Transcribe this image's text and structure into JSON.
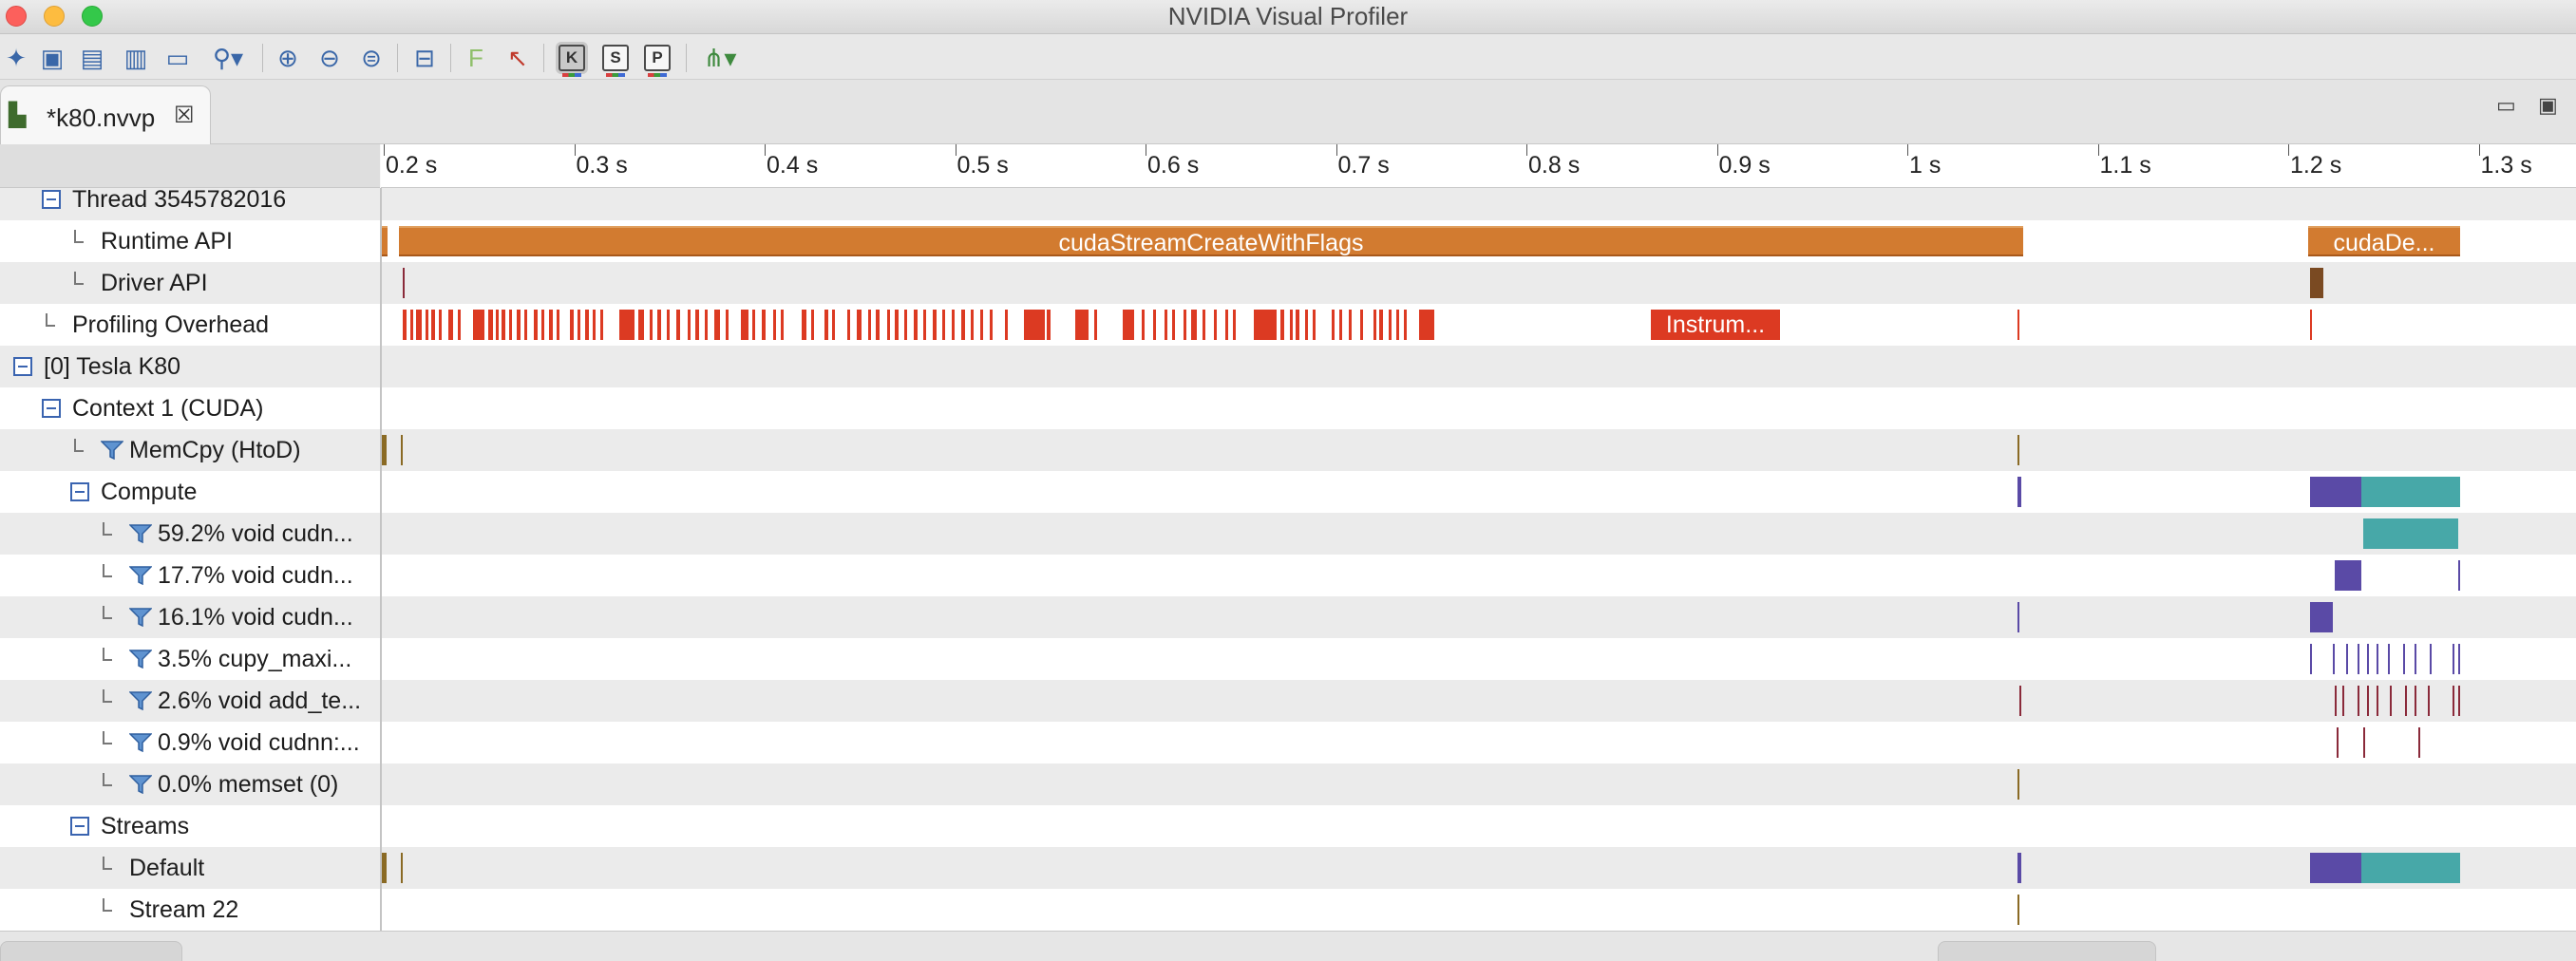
{
  "window": {
    "title": "NVIDIA Visual Profiler"
  },
  "toolbar": {
    "buttons": [
      {
        "name": "new-session-icon"
      },
      {
        "name": "save-icon"
      },
      {
        "name": "save-all-icon"
      },
      {
        "name": "import-chart-icon"
      },
      {
        "name": "export-icon"
      },
      {
        "name": "search-dropdown-icon"
      },
      {
        "name": "zoom-in-icon"
      },
      {
        "name": "zoom-out-icon"
      },
      {
        "name": "zoom-fit-icon"
      },
      {
        "name": "collapse-icon"
      },
      {
        "name": "filter-icon"
      },
      {
        "name": "clear-filter-icon"
      },
      {
        "name": "tree-dropdown-icon"
      }
    ],
    "kernel_toggles": [
      {
        "label": "K",
        "name": "kernel-toggle",
        "active": true
      },
      {
        "label": "S",
        "name": "stream-toggle",
        "active": false
      },
      {
        "label": "P",
        "name": "process-toggle",
        "active": false
      }
    ]
  },
  "editor": {
    "tab_label": "*k80.nvvp",
    "close_glyph": "☒"
  },
  "timeline": {
    "ruler_ticks": [
      "0.2 s",
      "0.3 s",
      "0.4 s",
      "0.5 s",
      "0.6 s",
      "0.7 s",
      "0.8 s",
      "0.9 s",
      "1 s",
      "1.1 s",
      "1.2 s",
      "1.3 s"
    ],
    "rows": [
      {
        "label": "Thread 3545782016",
        "kind": "collapse",
        "indent": 0
      },
      {
        "label": "Runtime API",
        "kind": "leaf",
        "indent": 1
      },
      {
        "label": "Driver API",
        "kind": "leaf",
        "indent": 1
      },
      {
        "label": "Profiling Overhead",
        "kind": "leaf",
        "indent": 0
      },
      {
        "label": "[0] Tesla K80",
        "kind": "collapse",
        "indent": -1
      },
      {
        "label": "Context 1 (CUDA)",
        "kind": "collapse",
        "indent": 0
      },
      {
        "label": "MemCpy (HtoD)",
        "kind": "filter",
        "indent": 1
      },
      {
        "label": "Compute",
        "kind": "collapse",
        "indent": 1
      },
      {
        "label": "59.2% void cudn...",
        "kind": "filter",
        "indent": 2
      },
      {
        "label": "17.7% void cudn...",
        "kind": "filter",
        "indent": 2
      },
      {
        "label": "16.1% void cudn...",
        "kind": "filter",
        "indent": 2
      },
      {
        "label": "3.5% cupy_maxi...",
        "kind": "filter",
        "indent": 2
      },
      {
        "label": "2.6% void add_te...",
        "kind": "filter",
        "indent": 2
      },
      {
        "label": "0.9% void cudnn:...",
        "kind": "filter",
        "indent": 2
      },
      {
        "label": "0.0% memset (0)",
        "kind": "filter",
        "indent": 2
      },
      {
        "label": "Streams",
        "kind": "collapse",
        "indent": 1
      },
      {
        "label": "Default",
        "kind": "leaf",
        "indent": 2
      },
      {
        "label": "Stream 22",
        "kind": "leaf",
        "indent": 2
      }
    ],
    "bar_labels": {
      "runtime_main": "cudaStreamCreateWithFlags",
      "runtime_end": "cudaDe...",
      "overhead": "Instrum..."
    }
  },
  "colors": {
    "runtime": "#d27b30",
    "overhead": "#dc3a22",
    "memcpy": "#8a6a24",
    "kernel_a": "#5a4aa6",
    "kernel_b": "#47a8a8",
    "kernel_c": "#8a2a3a"
  }
}
